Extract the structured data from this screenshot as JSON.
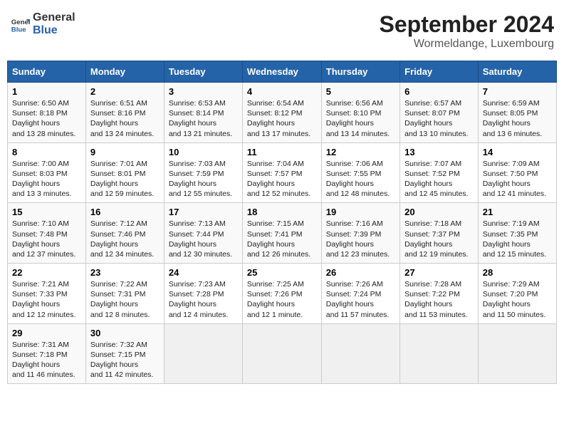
{
  "header": {
    "logo_line1": "General",
    "logo_line2": "Blue",
    "month_title": "September 2024",
    "location": "Wormeldange, Luxembourg"
  },
  "weekdays": [
    "Sunday",
    "Monday",
    "Tuesday",
    "Wednesday",
    "Thursday",
    "Friday",
    "Saturday"
  ],
  "weeks": [
    [
      {
        "day": "1",
        "sunrise": "6:50 AM",
        "sunset": "8:18 PM",
        "daylight": "13 hours and 28 minutes."
      },
      {
        "day": "2",
        "sunrise": "6:51 AM",
        "sunset": "8:16 PM",
        "daylight": "13 hours and 24 minutes."
      },
      {
        "day": "3",
        "sunrise": "6:53 AM",
        "sunset": "8:14 PM",
        "daylight": "13 hours and 21 minutes."
      },
      {
        "day": "4",
        "sunrise": "6:54 AM",
        "sunset": "8:12 PM",
        "daylight": "13 hours and 17 minutes."
      },
      {
        "day": "5",
        "sunrise": "6:56 AM",
        "sunset": "8:10 PM",
        "daylight": "13 hours and 14 minutes."
      },
      {
        "day": "6",
        "sunrise": "6:57 AM",
        "sunset": "8:07 PM",
        "daylight": "13 hours and 10 minutes."
      },
      {
        "day": "7",
        "sunrise": "6:59 AM",
        "sunset": "8:05 PM",
        "daylight": "13 hours and 6 minutes."
      }
    ],
    [
      {
        "day": "8",
        "sunrise": "7:00 AM",
        "sunset": "8:03 PM",
        "daylight": "13 hours and 3 minutes."
      },
      {
        "day": "9",
        "sunrise": "7:01 AM",
        "sunset": "8:01 PM",
        "daylight": "12 hours and 59 minutes."
      },
      {
        "day": "10",
        "sunrise": "7:03 AM",
        "sunset": "7:59 PM",
        "daylight": "12 hours and 55 minutes."
      },
      {
        "day": "11",
        "sunrise": "7:04 AM",
        "sunset": "7:57 PM",
        "daylight": "12 hours and 52 minutes."
      },
      {
        "day": "12",
        "sunrise": "7:06 AM",
        "sunset": "7:55 PM",
        "daylight": "12 hours and 48 minutes."
      },
      {
        "day": "13",
        "sunrise": "7:07 AM",
        "sunset": "7:52 PM",
        "daylight": "12 hours and 45 minutes."
      },
      {
        "day": "14",
        "sunrise": "7:09 AM",
        "sunset": "7:50 PM",
        "daylight": "12 hours and 41 minutes."
      }
    ],
    [
      {
        "day": "15",
        "sunrise": "7:10 AM",
        "sunset": "7:48 PM",
        "daylight": "12 hours and 37 minutes."
      },
      {
        "day": "16",
        "sunrise": "7:12 AM",
        "sunset": "7:46 PM",
        "daylight": "12 hours and 34 minutes."
      },
      {
        "day": "17",
        "sunrise": "7:13 AM",
        "sunset": "7:44 PM",
        "daylight": "12 hours and 30 minutes."
      },
      {
        "day": "18",
        "sunrise": "7:15 AM",
        "sunset": "7:41 PM",
        "daylight": "12 hours and 26 minutes."
      },
      {
        "day": "19",
        "sunrise": "7:16 AM",
        "sunset": "7:39 PM",
        "daylight": "12 hours and 23 minutes."
      },
      {
        "day": "20",
        "sunrise": "7:18 AM",
        "sunset": "7:37 PM",
        "daylight": "12 hours and 19 minutes."
      },
      {
        "day": "21",
        "sunrise": "7:19 AM",
        "sunset": "7:35 PM",
        "daylight": "12 hours and 15 minutes."
      }
    ],
    [
      {
        "day": "22",
        "sunrise": "7:21 AM",
        "sunset": "7:33 PM",
        "daylight": "12 hours and 12 minutes."
      },
      {
        "day": "23",
        "sunrise": "7:22 AM",
        "sunset": "7:31 PM",
        "daylight": "12 hours and 8 minutes."
      },
      {
        "day": "24",
        "sunrise": "7:23 AM",
        "sunset": "7:28 PM",
        "daylight": "12 hours and 4 minutes."
      },
      {
        "day": "25",
        "sunrise": "7:25 AM",
        "sunset": "7:26 PM",
        "daylight": "12 hours and 1 minute."
      },
      {
        "day": "26",
        "sunrise": "7:26 AM",
        "sunset": "7:24 PM",
        "daylight": "11 hours and 57 minutes."
      },
      {
        "day": "27",
        "sunrise": "7:28 AM",
        "sunset": "7:22 PM",
        "daylight": "11 hours and 53 minutes."
      },
      {
        "day": "28",
        "sunrise": "7:29 AM",
        "sunset": "7:20 PM",
        "daylight": "11 hours and 50 minutes."
      }
    ],
    [
      {
        "day": "29",
        "sunrise": "7:31 AM",
        "sunset": "7:18 PM",
        "daylight": "11 hours and 46 minutes."
      },
      {
        "day": "30",
        "sunrise": "7:32 AM",
        "sunset": "7:15 PM",
        "daylight": "11 hours and 42 minutes."
      },
      null,
      null,
      null,
      null,
      null
    ]
  ]
}
